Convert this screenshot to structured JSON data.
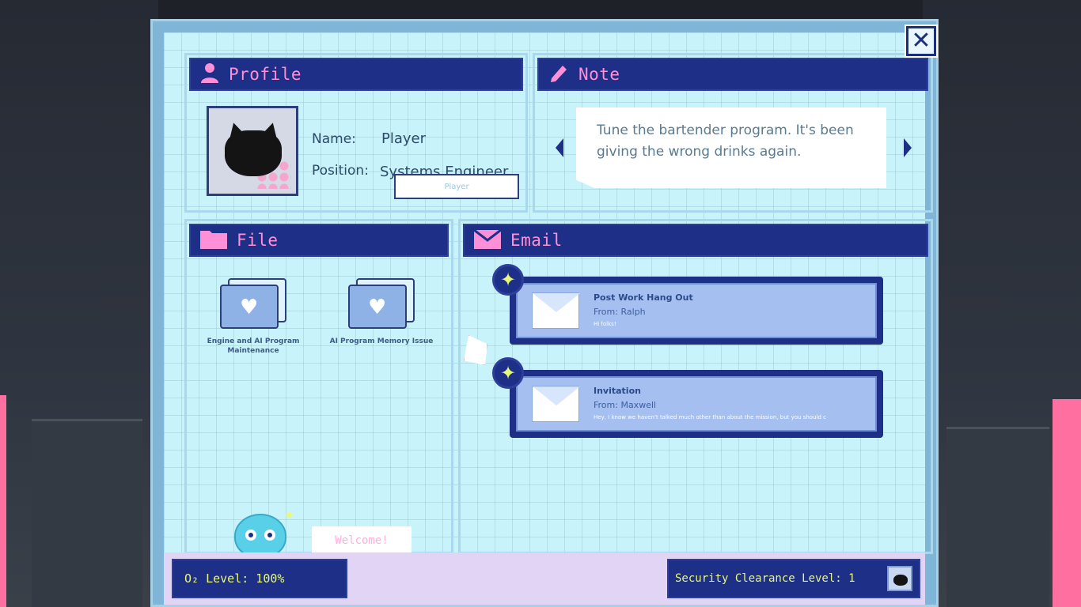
{
  "window": {
    "close_label": "✕"
  },
  "profile": {
    "title": "Profile",
    "name_label": "Name:",
    "name_value": "Player",
    "position_label": "Position:",
    "position_value": "Systems Engineer",
    "player_field": "Player"
  },
  "note": {
    "title": "Note",
    "text": "Tune the bartender program. It's been giving the wrong drinks again."
  },
  "file": {
    "title": "File",
    "folders": [
      {
        "label": "Engine and AI Program Maintenance"
      },
      {
        "label": "AI Program Memory Issue"
      }
    ],
    "welcome": "Welcome!"
  },
  "email": {
    "title": "Email",
    "messages": [
      {
        "subject": "Post Work Hang Out",
        "from": "From: Ralph",
        "preview": "Hi folks!"
      },
      {
        "subject": "Invitation",
        "from": "From: Maxwell",
        "preview": "Hey, I know we haven't talked much other than about the mission, but you should c"
      }
    ]
  },
  "status": {
    "o2": "O₂ Level: 100%",
    "security": "Security Clearance Level: 1"
  },
  "colors": {
    "header_bg": "#1d2f86",
    "header_text": "#ff8fd6",
    "screen_bg": "#c8f3fb",
    "status_text": "#e8f878",
    "accent_pink": "#ff6fa0"
  }
}
